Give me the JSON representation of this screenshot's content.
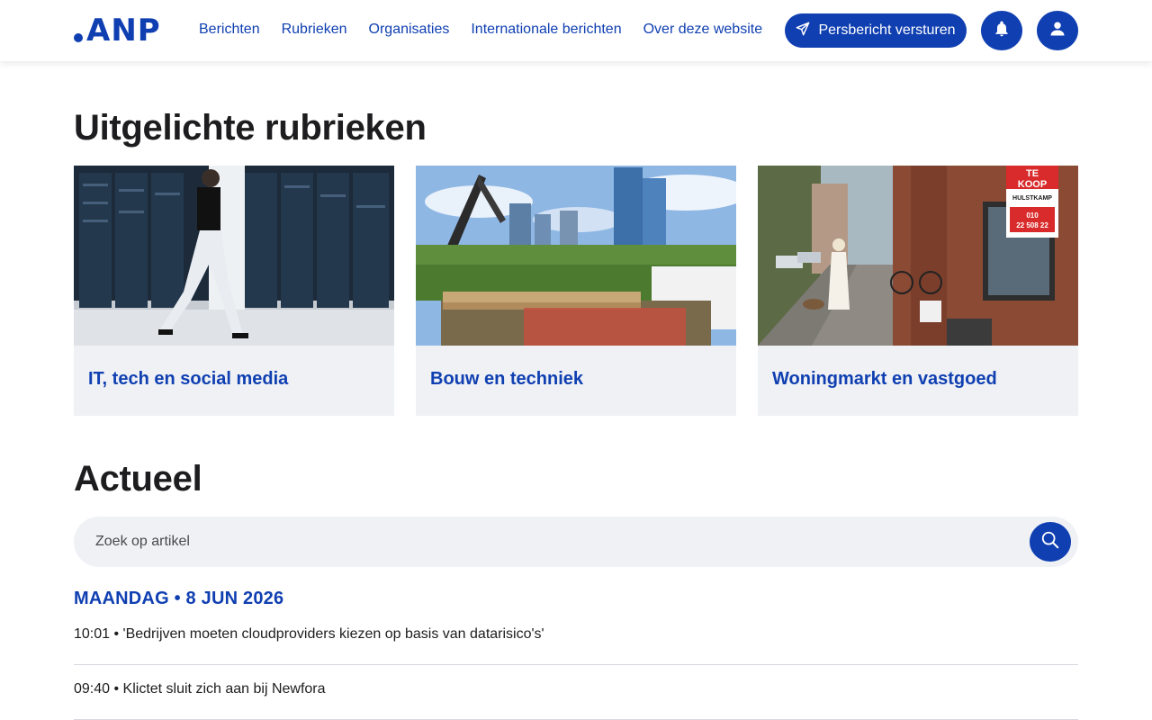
{
  "brand": {
    "logo_text": "ANP",
    "accent": "#0f3fb1"
  },
  "nav": {
    "items": [
      {
        "label": "Berichten"
      },
      {
        "label": "Rubrieken"
      },
      {
        "label": "Organisaties"
      },
      {
        "label": "Internationale berichten"
      },
      {
        "label": "Over deze website"
      }
    ],
    "send_button": "Persbericht versturen",
    "icons": [
      "paper-plane-icon",
      "bell-icon",
      "user-icon"
    ]
  },
  "featured": {
    "heading": "Uitgelichte rubrieken",
    "cards": [
      {
        "title": "IT, tech en social media",
        "image": "server-room-photo"
      },
      {
        "title": "Bouw en techniek",
        "image": "construction-site-photo"
      },
      {
        "title": "Woningmarkt en vastgoed",
        "image": "street-houses-photo"
      }
    ]
  },
  "actueel": {
    "heading": "Actueel",
    "search_placeholder": "Zoek op artikel",
    "date": "MAANDAG • 8 JUN 2026",
    "items": [
      {
        "text": "10:01 • 'Bedrijven moeten cloudproviders kiezen op basis van datarisico's'"
      },
      {
        "text": "09:40 • Klictet sluit zich aan bij Newfora"
      }
    ]
  },
  "sign": {
    "line1": "TE",
    "line2": "KOOP",
    "line3": "HULSTKAMP",
    "line4": "010",
    "line5": "22 508 22"
  }
}
